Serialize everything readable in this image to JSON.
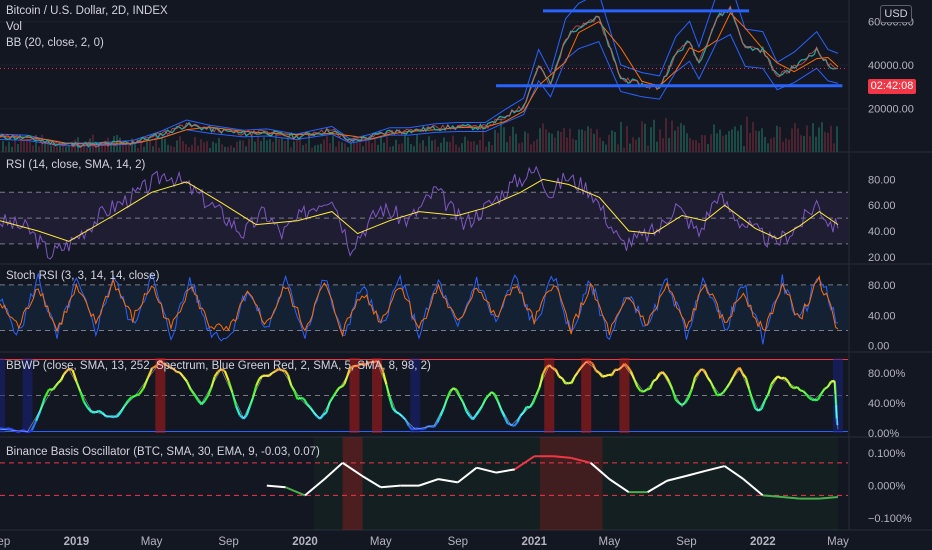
{
  "header": {
    "title": "Bitcoin / U.S. Dollar, 2D, INDEX",
    "vol_label": "Vol",
    "bb_label": "BB (20, close, 2, 0)"
  },
  "currency_button": "USD",
  "price_tag": "02:42:08",
  "indicators": {
    "rsi": "RSI (14, close, SMA, 14, 2)",
    "stoch": "Stoch RSI (3, 3, 14, 14, close)",
    "bbwp": "BBWP (close, SMA, 13, 252, Spectrum, Blue Green Red, 2, SMA, 5, SMA, 8, 98, 2)",
    "basis": "Binance Basis Oscillator (BTC, SMA, 30, EMA, 9, -0.03, 0.07)"
  },
  "colors": {
    "background": "#131722",
    "candle_up": "#26a69a",
    "candle_down": "#ef5350",
    "bb_band": "#2962ff",
    "bb_basis": "#ff6d00",
    "level_line": "#2962ff",
    "rsi": "#7e57c2",
    "rsi_ma": "#ffeb3b",
    "stoch_k": "#2962ff",
    "stoch_d": "#ff6d00",
    "basis_line": "#ffffff",
    "price_tag": "#f23645"
  },
  "chart_data": [
    {
      "type": "line",
      "title": "Bitcoin / U.S. Dollar, 2D, INDEX",
      "y_ticks": [
        "60000.00",
        "40000.00",
        "20000.00"
      ],
      "ylim": [
        0,
        70000
      ],
      "levels": [
        65000,
        30500
      ],
      "x_ticks": [
        "Sep",
        "2019",
        "May",
        "Sep",
        "2020",
        "May",
        "Sep",
        "2021",
        "May",
        "Sep",
        "2022",
        "May"
      ],
      "x_tick_dates": [
        "2018-09-01",
        "2019-01-01",
        "2019-05-01",
        "2019-09-01",
        "2020-01-01",
        "2020-05-01",
        "2020-09-01",
        "2021-01-01",
        "2021-05-01",
        "2021-09-01",
        "2022-01-01",
        "2022-05-01"
      ],
      "x_range": [
        "2018-09-01",
        "2022-05-01"
      ],
      "series": [
        {
          "x": [
            "2018-09-01",
            "2018-10-15",
            "2018-11-20",
            "2018-12-15",
            "2019-02-01",
            "2019-04-01",
            "2019-05-15",
            "2019-06-26",
            "2019-08-01",
            "2019-09-25",
            "2019-11-01",
            "2019-12-18",
            "2020-02-13",
            "2020-03-13",
            "2020-04-15",
            "2020-05-15",
            "2020-06-15",
            "2020-07-27",
            "2020-09-01",
            "2020-10-15",
            "2020-11-15",
            "2020-12-15",
            "2021-01-08",
            "2021-01-27",
            "2021-02-20",
            "2021-03-13",
            "2021-04-14",
            "2021-05-19",
            "2021-06-22",
            "2021-07-20",
            "2021-08-15",
            "2021-09-06",
            "2021-09-21",
            "2021-10-20",
            "2021-11-10",
            "2021-12-04",
            "2022-01-01",
            "2022-01-24",
            "2022-02-20",
            "2022-03-28",
            "2022-04-15",
            "2022-05-01"
          ],
          "values": [
            7000,
            6500,
            4500,
            3500,
            3500,
            4500,
            8000,
            12500,
            10500,
            8500,
            9000,
            7000,
            10000,
            5000,
            7000,
            9500,
            9500,
            11000,
            11500,
            11500,
            16500,
            21000,
            40000,
            31000,
            52000,
            58000,
            62000,
            34000,
            31000,
            29700,
            45000,
            51000,
            41000,
            62000,
            66000,
            48000,
            47000,
            35000,
            39000,
            47000,
            40000,
            38500
          ]
        }
      ]
    },
    {
      "type": "line",
      "title": "RSI (14, close, SMA, 14, 2)",
      "y_ticks": [
        "80.00",
        "60.00",
        "40.00",
        "20.00"
      ],
      "ylim": [
        16,
        95
      ],
      "bands": [
        70,
        50,
        30
      ],
      "x_range": [
        "2018-09-01",
        "2022-05-01"
      ],
      "series": [
        {
          "name": "RSI",
          "x": [
            "2018-09-01",
            "2018-10-15",
            "2018-11-20",
            "2018-12-20",
            "2019-02-15",
            "2019-04-05",
            "2019-05-25",
            "2019-06-26",
            "2019-08-10",
            "2019-09-25",
            "2019-10-28",
            "2019-11-25",
            "2020-01-15",
            "2020-02-13",
            "2020-03-13",
            "2020-05-01",
            "2020-06-15",
            "2020-07-28",
            "2020-09-10",
            "2020-10-25",
            "2020-12-01",
            "2021-01-08",
            "2021-01-27",
            "2021-02-20",
            "2021-04-01",
            "2021-05-20",
            "2021-06-22",
            "2021-07-20",
            "2021-08-15",
            "2021-09-21",
            "2021-10-20",
            "2021-11-25",
            "2022-01-20",
            "2022-03-01",
            "2022-03-28",
            "2022-04-15",
            "2022-05-01"
          ],
          "values": [
            48,
            42,
            22,
            30,
            55,
            68,
            85,
            75,
            58,
            38,
            55,
            38,
            60,
            68,
            28,
            58,
            48,
            72,
            45,
            62,
            78,
            88,
            68,
            82,
            72,
            30,
            35,
            42,
            60,
            38,
            68,
            48,
            30,
            45,
            62,
            48,
            42
          ]
        },
        {
          "name": "RSI-based MA",
          "x": [
            "2018-09-01",
            "2018-11-01",
            "2018-12-20",
            "2019-03-01",
            "2019-05-01",
            "2019-06-26",
            "2019-08-20",
            "2019-10-15",
            "2019-12-20",
            "2020-02-13",
            "2020-03-25",
            "2020-05-15",
            "2020-07-01",
            "2020-09-01",
            "2020-10-15",
            "2020-12-10",
            "2021-01-15",
            "2021-02-25",
            "2021-04-15",
            "2021-06-01",
            "2021-07-10",
            "2021-08-25",
            "2021-10-01",
            "2021-11-01",
            "2021-12-20",
            "2022-01-25",
            "2022-03-01",
            "2022-04-01",
            "2022-05-01"
          ],
          "values": [
            48,
            40,
            32,
            52,
            70,
            78,
            62,
            45,
            48,
            55,
            38,
            48,
            55,
            52,
            58,
            70,
            80,
            76,
            66,
            40,
            38,
            52,
            48,
            60,
            42,
            34,
            44,
            55,
            45
          ]
        }
      ]
    },
    {
      "type": "line",
      "title": "Stoch RSI (3, 3, 14, 14, close)",
      "y_ticks": [
        "80.00",
        "40.00",
        "0.00"
      ],
      "ylim": [
        -3,
        97
      ],
      "bands": [
        80,
        20
      ],
      "x_range": [
        "2018-09-01",
        "2022-05-01"
      ],
      "series": [
        {
          "name": "K",
          "x": [
            "2018-09-01",
            "2018-10-01",
            "2018-11-01",
            "2018-12-01",
            "2019-01-01",
            "2019-02-01",
            "2019-03-01",
            "2019-04-01",
            "2019-05-01",
            "2019-06-01",
            "2019-07-01",
            "2019-08-01",
            "2019-09-01",
            "2019-10-01",
            "2019-11-01",
            "2019-12-01",
            "2020-01-01",
            "2020-02-01",
            "2020-03-01",
            "2020-04-01",
            "2020-05-01",
            "2020-06-01",
            "2020-07-01",
            "2020-08-01",
            "2020-09-01",
            "2020-10-01",
            "2020-11-01",
            "2020-12-01",
            "2021-01-01",
            "2021-02-01",
            "2021-03-01",
            "2021-04-01",
            "2021-05-01",
            "2021-06-01",
            "2021-07-01",
            "2021-08-01",
            "2021-09-01",
            "2021-10-01",
            "2021-11-01",
            "2021-12-01",
            "2022-01-01",
            "2022-02-01",
            "2022-03-01",
            "2022-04-01",
            "2022-05-01"
          ],
          "values": [
            60,
            15,
            90,
            10,
            85,
            20,
            92,
            25,
            90,
            12,
            88,
            20,
            10,
            75,
            20,
            85,
            15,
            90,
            10,
            80,
            25,
            90,
            15,
            85,
            20,
            88,
            30,
            90,
            25,
            92,
            15,
            85,
            10,
            70,
            20,
            88,
            15,
            90,
            20,
            80,
            10,
            85,
            30,
            95,
            30
          ]
        },
        {
          "name": "D",
          "x": [
            "2018-09-01",
            "2018-10-01",
            "2018-11-01",
            "2018-12-01",
            "2019-01-01",
            "2019-02-01",
            "2019-03-01",
            "2019-04-01",
            "2019-05-01",
            "2019-06-01",
            "2019-07-01",
            "2019-08-01",
            "2019-09-01",
            "2019-10-01",
            "2019-11-01",
            "2019-12-01",
            "2020-01-01",
            "2020-02-01",
            "2020-03-01",
            "2020-04-01",
            "2020-05-01",
            "2020-06-01",
            "2020-07-01",
            "2020-08-01",
            "2020-09-01",
            "2020-10-01",
            "2020-11-01",
            "2020-12-01",
            "2021-01-01",
            "2021-02-01",
            "2021-03-01",
            "2021-04-01",
            "2021-05-01",
            "2021-06-01",
            "2021-07-01",
            "2021-08-01",
            "2021-09-01",
            "2021-10-01",
            "2021-11-01",
            "2021-12-01",
            "2022-01-01",
            "2022-02-01",
            "2022-03-01",
            "2022-04-01",
            "2022-05-01"
          ],
          "values": [
            55,
            25,
            80,
            20,
            75,
            30,
            85,
            35,
            80,
            22,
            80,
            28,
            18,
            68,
            28,
            78,
            22,
            82,
            18,
            72,
            32,
            82,
            22,
            78,
            28,
            80,
            35,
            82,
            32,
            85,
            22,
            78,
            18,
            62,
            28,
            80,
            22,
            82,
            28,
            72,
            18,
            78,
            35,
            88,
            22
          ]
        }
      ]
    },
    {
      "type": "line",
      "title": "BBWP (close, SMA, 13, 252, Spectrum, Blue Green Red, 2, SMA, 5, SMA, 8, 98, 2)",
      "y_ticks": [
        "80.00%",
        "40.00%",
        "0.00%"
      ],
      "ylim": [
        0,
        100
      ],
      "bands": [
        98,
        50,
        2
      ],
      "x_range": [
        "2018-09-01",
        "2022-05-01"
      ],
      "series": [
        {
          "name": "BBWP",
          "x": [
            "2018-09-01",
            "2018-10-15",
            "2018-11-25",
            "2018-12-20",
            "2019-01-25",
            "2019-03-01",
            "2019-04-05",
            "2019-05-15",
            "2019-06-15",
            "2019-07-20",
            "2019-08-20",
            "2019-09-25",
            "2019-10-25",
            "2019-11-25",
            "2019-12-25",
            "2020-01-25",
            "2020-02-25",
            "2020-03-20",
            "2020-04-25",
            "2020-05-25",
            "2020-06-25",
            "2020-07-25",
            "2020-08-25",
            "2020-09-25",
            "2020-10-25",
            "2020-11-25",
            "2020-12-25",
            "2021-01-25",
            "2021-02-25",
            "2021-03-25",
            "2021-04-25",
            "2021-05-25",
            "2021-06-25",
            "2021-07-25",
            "2021-08-25",
            "2021-09-25",
            "2021-10-25",
            "2021-11-25",
            "2021-12-25",
            "2022-01-25",
            "2022-02-25",
            "2022-03-25",
            "2022-04-25",
            "2022-05-01"
          ],
          "values": [
            5,
            2,
            60,
            85,
            30,
            20,
            50,
            95,
            80,
            40,
            85,
            20,
            75,
            85,
            45,
            20,
            60,
            90,
            95,
            30,
            5,
            10,
            60,
            20,
            55,
            10,
            35,
            90,
            65,
            95,
            75,
            90,
            55,
            80,
            35,
            85,
            50,
            85,
            30,
            75,
            60,
            45,
            70,
            5
          ]
        }
      ]
    },
    {
      "type": "line",
      "title": "Binance Basis Oscillator (BTC, SMA, 30, EMA, 9, -0.03, 0.07)",
      "y_ticks": [
        "0.100%",
        "0.000%",
        "−0.100%"
      ],
      "ylim": [
        -0.13,
        0.14
      ],
      "bands": [
        0.07,
        -0.03
      ],
      "x_range": [
        "2018-09-01",
        "2022-05-01"
      ],
      "series": [
        {
          "name": "Basis",
          "x": [
            "2019-11-01",
            "2019-12-01",
            "2020-01-01",
            "2020-02-01",
            "2020-03-01",
            "2020-04-01",
            "2020-05-01",
            "2020-06-01",
            "2020-07-01",
            "2020-08-01",
            "2020-09-01",
            "2020-10-01",
            "2020-11-01",
            "2020-12-01",
            "2021-01-01",
            "2021-02-01",
            "2021-03-01",
            "2021-04-01",
            "2021-05-01",
            "2021-06-01",
            "2021-07-01",
            "2021-08-01",
            "2021-09-01",
            "2021-10-01",
            "2021-11-01",
            "2021-12-01",
            "2022-01-01",
            "2022-02-01",
            "2022-03-01",
            "2022-04-01",
            "2022-05-01"
          ],
          "values": [
            0.0,
            -0.005,
            -0.03,
            0.02,
            0.07,
            0.03,
            -0.005,
            0.0,
            0.0,
            0.02,
            0.01,
            0.055,
            0.04,
            0.05,
            0.09,
            0.09,
            0.085,
            0.07,
            0.02,
            -0.02,
            -0.02,
            0.015,
            0.03,
            0.045,
            0.06,
            0.02,
            -0.03,
            -0.035,
            -0.04,
            -0.04,
            -0.035
          ]
        }
      ]
    }
  ]
}
